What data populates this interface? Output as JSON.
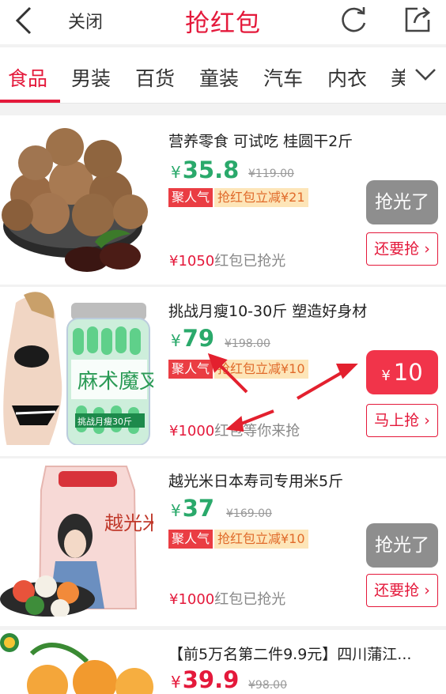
{
  "header": {
    "close_label": "关闭",
    "title": "抢红包"
  },
  "tabs": [
    {
      "label": "食品",
      "active": true
    },
    {
      "label": "男装"
    },
    {
      "label": "百货"
    },
    {
      "label": "童装"
    },
    {
      "label": "汽车"
    },
    {
      "label": "内衣"
    },
    {
      "label": "美"
    }
  ],
  "products": [
    {
      "name": "营养零食 可试吃 桂圆干2斤",
      "currency": "¥",
      "price": "35.8",
      "orig_price": "¥119.00",
      "tag_popular": "聚人气",
      "tag_discount": "抢红包立减¥21",
      "status_amount": "¥1050",
      "status_text": "红包已抢光",
      "button_label": "抢光了",
      "link_label": "还要抢"
    },
    {
      "name": "挑战月瘦10-30斤 塑造好身材",
      "currency": "¥",
      "price": "79",
      "orig_price": "¥198.00",
      "tag_popular": "聚人气",
      "tag_discount": "抢红包立减¥10",
      "status_amount": "¥1000",
      "status_text": "红包等你来抢",
      "button_currency": "¥",
      "button_amount": "10",
      "link_label": "马上抢"
    },
    {
      "name": "越光米日本寿司专用米5斤",
      "currency": "¥",
      "price": "37",
      "orig_price": "¥169.00",
      "tag_popular": "聚人气",
      "tag_discount": "抢红包立减¥10",
      "status_amount": "¥1000",
      "status_text": "红包已抢光",
      "button_label": "抢光了",
      "link_label": "还要抢"
    },
    {
      "name": "【前5万名第二件9.9元】四川蒲江...",
      "currency": "¥",
      "price": "39.9",
      "orig_price": "¥98.00"
    }
  ],
  "product_image_text": {
    "jar_brand": "麻术魔叉",
    "jar_band": "挑战月瘦30斤",
    "rice_brand": "越光米"
  },
  "colors": {
    "accent": "#e4193b",
    "price_green": "#2aa96b",
    "sold_out_gray": "#8e8e8e",
    "tag_bg": "#fde5b8"
  }
}
